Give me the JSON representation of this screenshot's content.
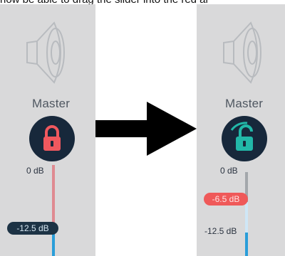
{
  "caption": "now be able to drag the slider into the red ar",
  "left_panel": {
    "channel_label": "Master",
    "lock_state": "locked",
    "lock_icon": "padlock-closed-icon",
    "lock_color": "#f0585e",
    "top_level_label": "0 dB",
    "slider_value_label": "-12.5 dB"
  },
  "right_panel": {
    "channel_label": "Master",
    "lock_state": "unlocked",
    "lock_icon": "padlock-open-icon",
    "lock_color": "#22b8a8",
    "top_level_label": "0 dB",
    "slider_value_label": "-6.5 dB",
    "limit_label": "-12.5 dB"
  },
  "arrow_icon": "right-arrow-icon"
}
